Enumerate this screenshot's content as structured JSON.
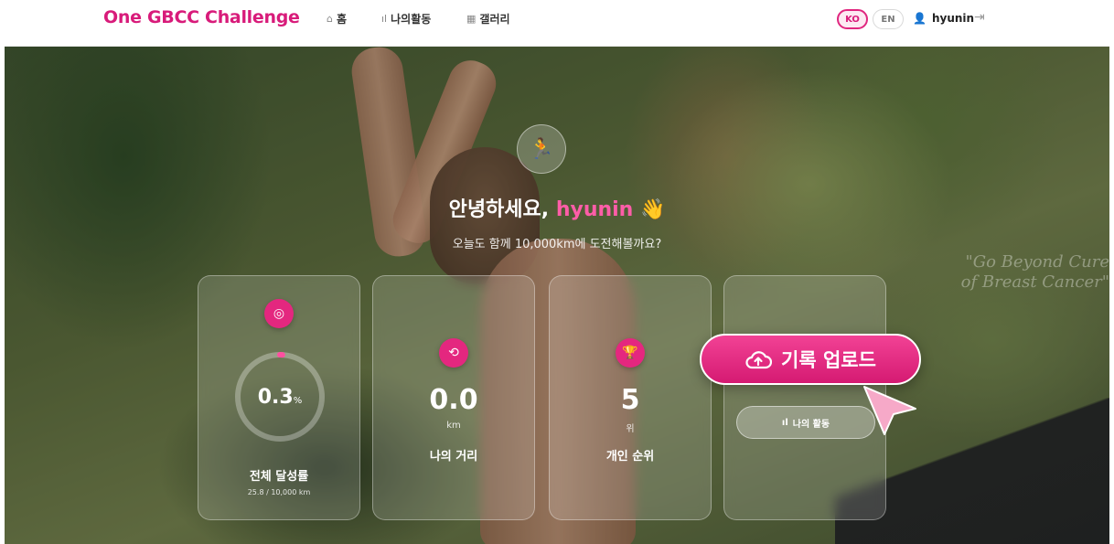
{
  "header": {
    "brand": "One GBCC Challenge",
    "nav": [
      {
        "icon": "home-icon",
        "label": "홈"
      },
      {
        "icon": "bar-chart-icon",
        "label": "나의활동"
      },
      {
        "icon": "grid-icon",
        "label": "갤러리"
      }
    ],
    "lang": {
      "ko": "KO",
      "en": "EN",
      "active": "KO"
    },
    "username": "hyunin",
    "accent_color": "#d81b7a"
  },
  "hero": {
    "greeting": "안녕하세요,",
    "username": "hyunin",
    "wave": "👋",
    "subtitle": "오늘도 함께 10,000km에 도전해볼까요?",
    "watermark_line1": "\"Go Beyond Cure",
    "watermark_line2": "of Breast Cancer\""
  },
  "cards": {
    "progress": {
      "value": "0.3",
      "unit": "%",
      "progress_fraction": 0.003,
      "title": "전체 달성률",
      "detail": "25.8 / 10,000 km"
    },
    "distance": {
      "value": "0.0",
      "unit": "km",
      "title": "나의 거리"
    },
    "rank": {
      "value": "5",
      "unit": "위",
      "title": "개인 순위"
    },
    "actions": {
      "upload_label": "기록 업로드",
      "activity_label": "나의 활동"
    }
  }
}
